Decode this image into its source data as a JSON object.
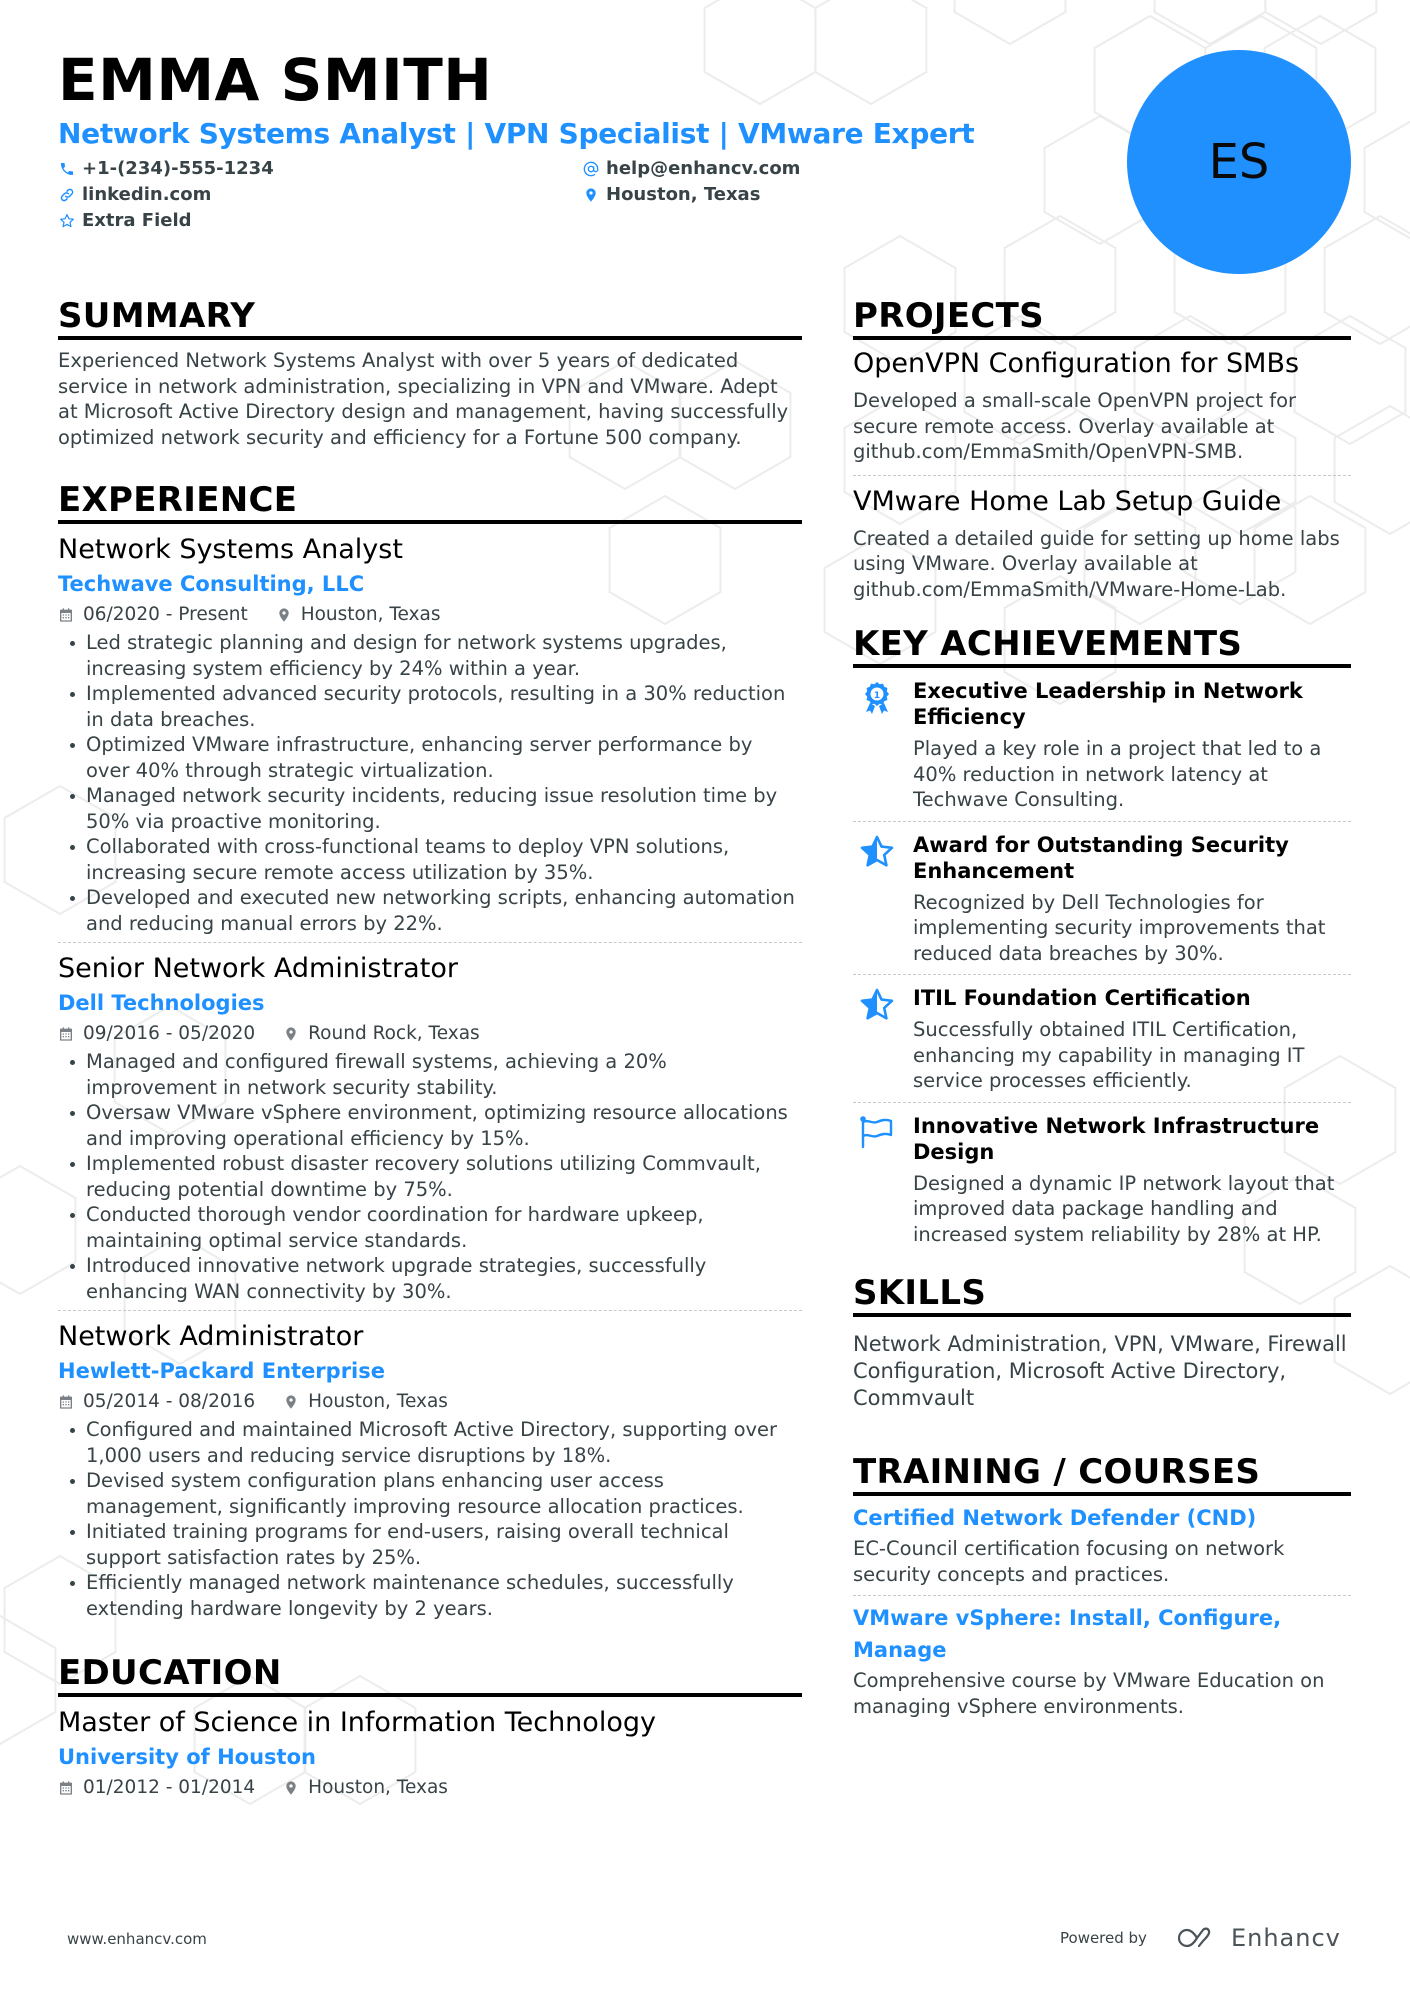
{
  "header": {
    "name": "EMMA SMITH",
    "headline": "Network Systems Analyst | VPN Specialist | VMware Expert",
    "initials": "ES",
    "contacts": {
      "phone": {
        "icon": "phone-icon",
        "value": "+1-(234)-555-1234"
      },
      "email": {
        "icon": "at-icon",
        "value": "help@enhancv.com"
      },
      "linkedin": {
        "icon": "link-icon",
        "value": "linkedin.com"
      },
      "location": {
        "icon": "map-pin-icon",
        "value": "Houston, Texas"
      },
      "extra": {
        "icon": "star-outline-icon",
        "value": "Extra Field"
      }
    }
  },
  "colors": {
    "accent": "#1e90ff",
    "text": "#384347",
    "heading": "#000000",
    "avatar_bg": "#2090ff"
  },
  "summary": {
    "title": "SUMMARY",
    "text": "Experienced Network Systems Analyst with over 5 years of dedicated service in network administration, specializing in VPN and VMware. Adept at Microsoft Active Directory design and management, having successfully optimized network security and efficiency for a Fortune 500 company."
  },
  "experience": {
    "title": "EXPERIENCE",
    "items": [
      {
        "role": "Network Systems Analyst",
        "company": "Techwave Consulting, LLC",
        "dates": "06/2020 - Present",
        "location": "Houston, Texas",
        "bullets": [
          "Led strategic planning and design for network systems upgrades, increasing system efficiency by 24% within a year.",
          "Implemented advanced security protocols, resulting in a 30% reduction in data breaches.",
          "Optimized VMware infrastructure, enhancing server performance by over 40% through strategic virtualization.",
          "Managed network security incidents, reducing issue resolution time by 50% via proactive monitoring.",
          "Collaborated with cross-functional teams to deploy VPN solutions, increasing secure remote access utilization by 35%.",
          "Developed and executed new networking scripts, enhancing automation and reducing manual errors by 22%."
        ]
      },
      {
        "role": "Senior Network Administrator",
        "company": "Dell Technologies",
        "dates": "09/2016 - 05/2020",
        "location": "Round Rock, Texas",
        "bullets": [
          "Managed and configured firewall systems, achieving a 20% improvement in network security stability.",
          "Oversaw VMware vSphere environment, optimizing resource allocations and improving operational efficiency by 15%.",
          "Implemented robust disaster recovery solutions utilizing Commvault, reducing potential downtime by 75%.",
          "Conducted thorough vendor coordination for hardware upkeep, maintaining optimal service standards.",
          "Introduced innovative network upgrade strategies, successfully enhancing WAN connectivity by 30%."
        ]
      },
      {
        "role": "Network Administrator",
        "company": "Hewlett-Packard Enterprise",
        "dates": "05/2014 - 08/2016",
        "location": "Houston, Texas",
        "bullets": [
          "Configured and maintained Microsoft Active Directory, supporting over 1,000 users and reducing service disruptions by 18%.",
          "Devised system configuration plans enhancing user access management, significantly improving resource allocation practices.",
          "Initiated training programs for end-users, raising overall technical support satisfaction rates by 25%.",
          "Efficiently managed network maintenance schedules, successfully extending hardware longevity by 2 years."
        ]
      }
    ]
  },
  "education": {
    "title": "EDUCATION",
    "items": [
      {
        "degree": "Master of Science in Information Technology",
        "school": "University of Houston",
        "dates": "01/2012 - 01/2014",
        "location": "Houston, Texas"
      }
    ]
  },
  "projects": {
    "title": "PROJECTS",
    "items": [
      {
        "title": "OpenVPN Configuration for SMBs",
        "text": "Developed a small-scale OpenVPN project for secure remote access. Overlay available at github.com/EmmaSmith/OpenVPN-SMB."
      },
      {
        "title": "VMware Home Lab Setup Guide",
        "text": "Created a detailed guide for setting up home labs using VMware. Overlay available at github.com/EmmaSmith/VMware-Home-Lab."
      }
    ]
  },
  "achievements": {
    "title": "KEY ACHIEVEMENTS",
    "items": [
      {
        "icon": "award-ribbon-icon",
        "title": "Executive Leadership in Network Efficiency",
        "text": "Played a key role in a project that led to a 40% reduction in network latency at Techwave Consulting."
      },
      {
        "icon": "star-half-icon",
        "title": "Award for Outstanding Security Enhancement",
        "text": "Recognized by Dell Technologies for implementing security improvements that reduced data breaches by 30%."
      },
      {
        "icon": "star-half-icon",
        "title": "ITIL Foundation Certification",
        "text": "Successfully obtained ITIL Certification, enhancing my capability in managing IT service processes efficiently."
      },
      {
        "icon": "flag-icon",
        "title": "Innovative Network Infrastructure Design",
        "text": "Designed a dynamic IP network layout that improved data package handling and increased system reliability by 28% at HP."
      }
    ]
  },
  "skills": {
    "title": "SKILLS",
    "text": "Network Administration, VPN, VMware, Firewall Configuration, Microsoft Active Directory, Commvault"
  },
  "training": {
    "title": "TRAINING / COURSES",
    "items": [
      {
        "title": "Certified Network Defender (CND)",
        "text": "EC-Council certification focusing on network security concepts and practices."
      },
      {
        "title": "VMware vSphere: Install, Configure, Manage",
        "text": "Comprehensive course by VMware Education on managing vSphere environments."
      }
    ]
  },
  "footer": {
    "website": "www.enhancv.com",
    "powered_by": "Powered by",
    "brand": "Enhancv"
  }
}
